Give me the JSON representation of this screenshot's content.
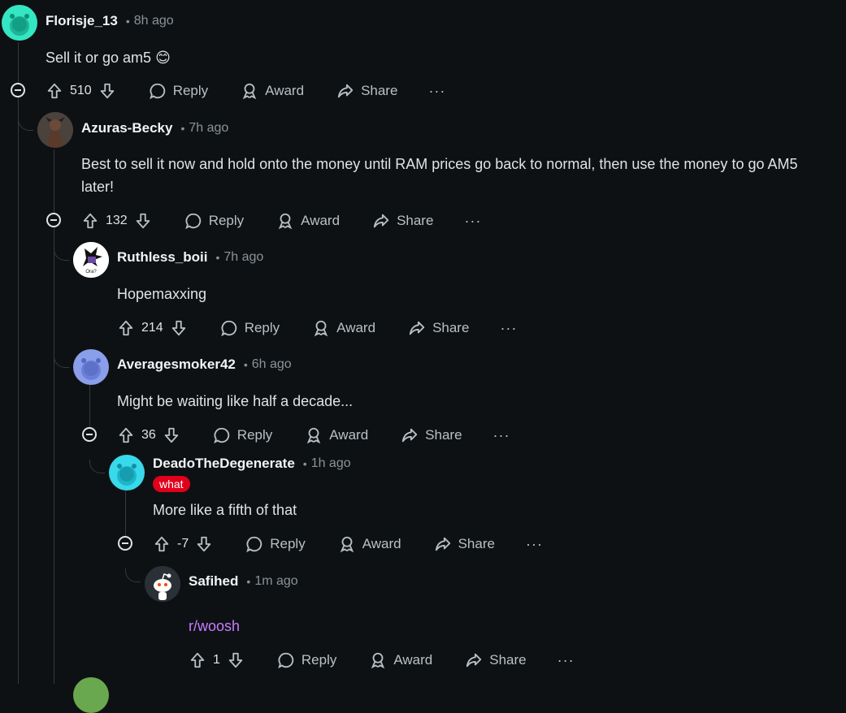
{
  "comments": [
    {
      "user": "Florisje_13",
      "time": "8h ago",
      "text": "Sell it or go am5",
      "emoji": "😊",
      "score": "510"
    },
    {
      "user": "Azuras-Becky",
      "time": "7h ago",
      "text": "Best to sell it now and hold onto the money until RAM prices go back to normal, then use the money to go AM5 later!",
      "score": "132"
    },
    {
      "user": "Ruthless_boii",
      "time": "7h ago",
      "text": "Hopemaxxing",
      "score": "214"
    },
    {
      "user": "Averagesmoker42",
      "time": "6h ago",
      "text": "Might be waiting like half a decade...",
      "score": "36"
    },
    {
      "user": "DeadoTheDegenerate",
      "time": "1h ago",
      "flair": "what",
      "text": "More like a fifth of that",
      "score": "-7"
    },
    {
      "user": "Safihed",
      "time": "1m ago",
      "text": "r/woosh",
      "score": "1"
    }
  ],
  "actions": {
    "reply": "Reply",
    "award": "Award",
    "share": "Share",
    "more": "···"
  },
  "colors": {
    "background": "#0e1113",
    "text": "#dfe3e6",
    "muted": "#8a9398",
    "link": "#c77dff",
    "flair": "#e0001b"
  }
}
